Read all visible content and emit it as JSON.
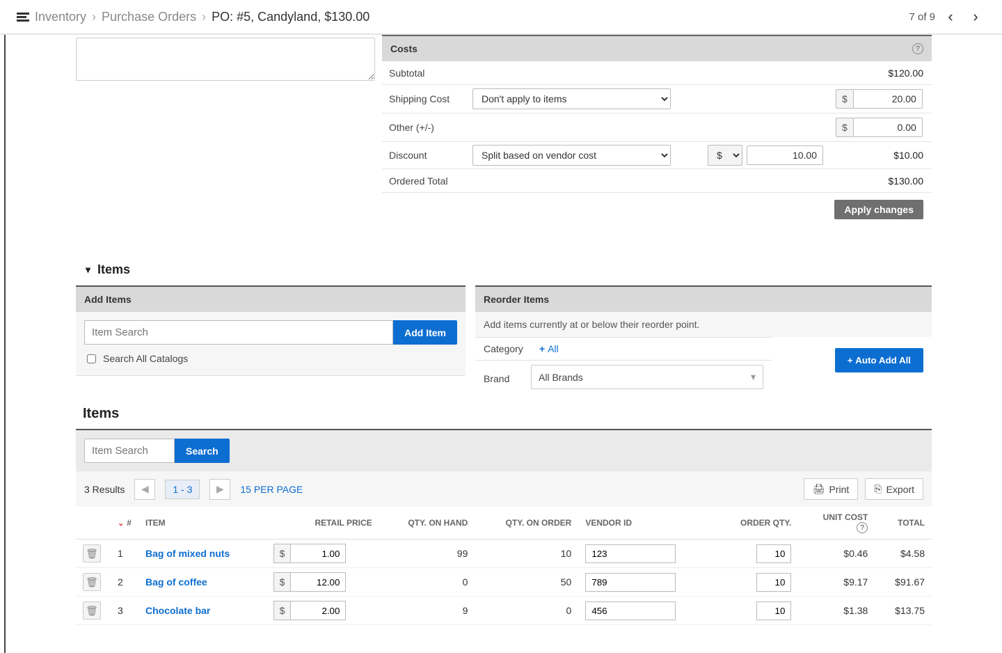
{
  "breadcrumb": {
    "l1": "Inventory",
    "l2": "Purchase Orders",
    "current": "PO:  #5, Candyland, $130.00"
  },
  "pager": {
    "text": "7 of 9"
  },
  "costs": {
    "title": "Costs",
    "subtotal_label": "Subtotal",
    "subtotal": "$120.00",
    "shipping_label": "Shipping Cost",
    "shipping_select": "Don't apply to items",
    "shipping_amt": "20.00",
    "other_label": "Other (+/-)",
    "other_amt": "0.00",
    "discount_label": "Discount",
    "discount_select": "Split based on vendor cost",
    "discount_curr": "$",
    "discount_amt": "10.00",
    "discount_total": "$10.00",
    "ordered_label": "Ordered Total",
    "ordered_total": "$130.00",
    "apply": "Apply changes"
  },
  "itemsSection": {
    "title": "Items"
  },
  "addItems": {
    "title": "Add Items",
    "placeholder": "Item Search",
    "button": "Add Item",
    "checkbox": "Search All Catalogs"
  },
  "reorder": {
    "title": "Reorder Items",
    "help": "Add items currently at or below their reorder point.",
    "category_label": "Category",
    "category_all": "All",
    "brand_label": "Brand",
    "brand_value": "All Brands",
    "auto": "Auto Add All"
  },
  "itemsList": {
    "title": "Items",
    "placeholder": "Item Search",
    "search": "Search",
    "results": "3 Results",
    "range": "1 - 3",
    "perpage": "15 PER PAGE",
    "print": "Print",
    "export": "Export",
    "headers": {
      "num": "#",
      "item": "ITEM",
      "retail": "RETAIL PRICE",
      "onhand": "QTY. ON HAND",
      "onorder": "QTY. ON ORDER",
      "vendor": "VENDOR ID",
      "orderqty": "ORDER QTY.",
      "unitcost": "UNIT COST",
      "total": "TOTAL"
    },
    "rows": [
      {
        "n": "1",
        "name": "Bag of mixed nuts",
        "retail": "1.00",
        "onhand": "99",
        "onorder": "10",
        "vendor": "123",
        "orderqty": "10",
        "unit": "$0.46",
        "total": "$4.58"
      },
      {
        "n": "2",
        "name": "Bag of coffee",
        "retail": "12.00",
        "onhand": "0",
        "onorder": "50",
        "vendor": "789",
        "orderqty": "10",
        "unit": "$9.17",
        "total": "$91.67"
      },
      {
        "n": "3",
        "name": "Chocolate bar",
        "retail": "2.00",
        "onhand": "9",
        "onorder": "0",
        "vendor": "456",
        "orderqty": "10",
        "unit": "$1.38",
        "total": "$13.75"
      }
    ]
  }
}
